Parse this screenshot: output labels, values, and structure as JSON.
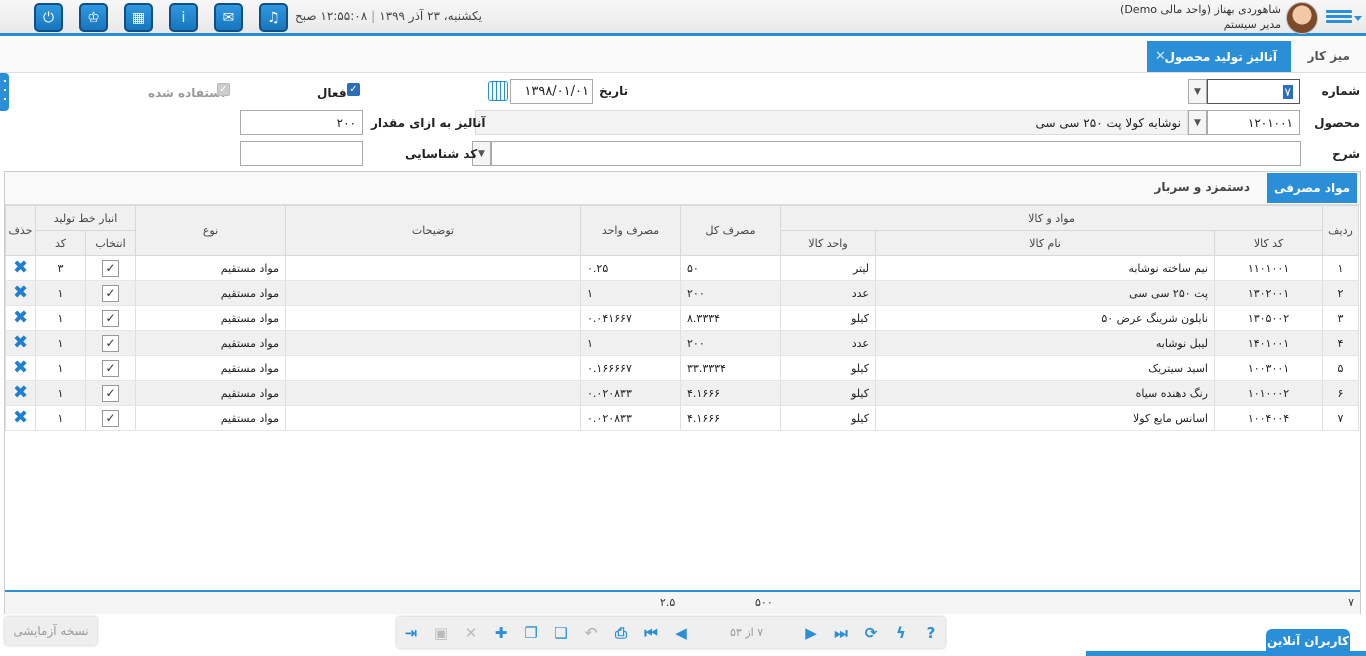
{
  "header": {
    "user_name": "شاهوردی بهناز (واحد مالی Demo)",
    "user_role": "مدیر سیستم",
    "date": "یکشنبه، ۲۳ آذر ۱۳۹۹",
    "time": "۱۲:۵۵:۰۸ صبح",
    "icons": [
      "power-icon",
      "crown-icon",
      "calculator-icon",
      "info-icon",
      "mail-icon",
      "bell-icon"
    ]
  },
  "tabs": {
    "desk": "میز کار",
    "active": "آنالیز تولید محصول"
  },
  "form": {
    "number_label": "شماره",
    "number_value": "۷",
    "date_label": "تاریخ",
    "date_value": "۱۳۹۸/۰۱/۰۱",
    "active_label": "فعال",
    "used_label": "استفاده شده",
    "product_label": "محصول",
    "product_code": "۱۲۰۱۰۰۱",
    "product_name": "نوشابه کولا پت ۲۵۰ سی سی",
    "analysis_qty_label": "آنالیز به ازای مقدار",
    "analysis_qty_value": "۲۰۰",
    "desc_label": "شرح",
    "desc_value": "",
    "id_code_label": "کد شناسایی",
    "id_code_value": ""
  },
  "subtabs": {
    "active": "مواد مصرفی",
    "other": "دستمزد و سربار"
  },
  "grid": {
    "headers": {
      "row": "ردیف",
      "goods_group": "مواد و کالا",
      "code": "کد کالا",
      "name": "نام کالا",
      "unit": "واحد کالا",
      "total": "مصرف کل",
      "unit_cons": "مصرف واحد",
      "desc": "توضیحات",
      "type": "نوع",
      "warehouse_group": "انبار خط تولید",
      "select": "انتخاب",
      "wcode": "کد",
      "delete": "حذف"
    },
    "rows": [
      {
        "row": "۱",
        "code": "۱۱۰۱۰۰۱",
        "name": "نیم ساخته نوشابه",
        "unit": "لیتر",
        "total": "۵۰",
        "unit_cons": "۰.۲۵",
        "desc": "",
        "type": "مواد مستقیم",
        "wcode": "۳"
      },
      {
        "row": "۲",
        "code": "۱۳۰۲۰۰۱",
        "name": "پت ۲۵۰ سی سی",
        "unit": "عدد",
        "total": "۲۰۰",
        "unit_cons": "۱",
        "desc": "",
        "type": "مواد مستقیم",
        "wcode": "۱"
      },
      {
        "row": "۳",
        "code": "۱۳۰۵۰۰۲",
        "name": "نایلون شرینگ عرض ۵۰",
        "unit": "کیلو",
        "total": "۸.۳۳۳۴",
        "unit_cons": "۰.۰۴۱۶۶۷",
        "desc": "",
        "type": "مواد مستقیم",
        "wcode": "۱"
      },
      {
        "row": "۴",
        "code": "۱۴۰۱۰۰۱",
        "name": "لیبل نوشابه",
        "unit": "عدد",
        "total": "۲۰۰",
        "unit_cons": "۱",
        "desc": "",
        "type": "مواد مستقیم",
        "wcode": "۱"
      },
      {
        "row": "۵",
        "code": "۱۰۰۳۰۰۱",
        "name": "اسید سیتریک",
        "unit": "کیلو",
        "total": "۳۳.۳۳۳۴",
        "unit_cons": "۰.۱۶۶۶۶۷",
        "desc": "",
        "type": "مواد مستقیم",
        "wcode": "۱"
      },
      {
        "row": "۶",
        "code": "۱۰۱۰۰۰۲",
        "name": "رنگ دهنده سیاه",
        "unit": "کیلو",
        "total": "۴.۱۶۶۶",
        "unit_cons": "۰.۰۲۰۸۳۳",
        "desc": "",
        "type": "مواد مستقیم",
        "wcode": "۱"
      },
      {
        "row": "۷",
        "code": "۱۰۰۴۰۰۴",
        "name": "اسانس مایع کولا",
        "unit": "کیلو",
        "total": "۴.۱۶۶۶",
        "unit_cons": "۰.۰۲۰۸۳۳",
        "desc": "",
        "type": "مواد مستقیم",
        "wcode": "۱"
      }
    ],
    "footer": {
      "count": "۷",
      "total": "۵۰۰",
      "unit_cons": "۲.۵"
    }
  },
  "toolbar": {
    "pager": "۷ از ۵۳"
  },
  "trial_label": "نسخه آزمایشی",
  "online_users": "کاربران آنلاین"
}
